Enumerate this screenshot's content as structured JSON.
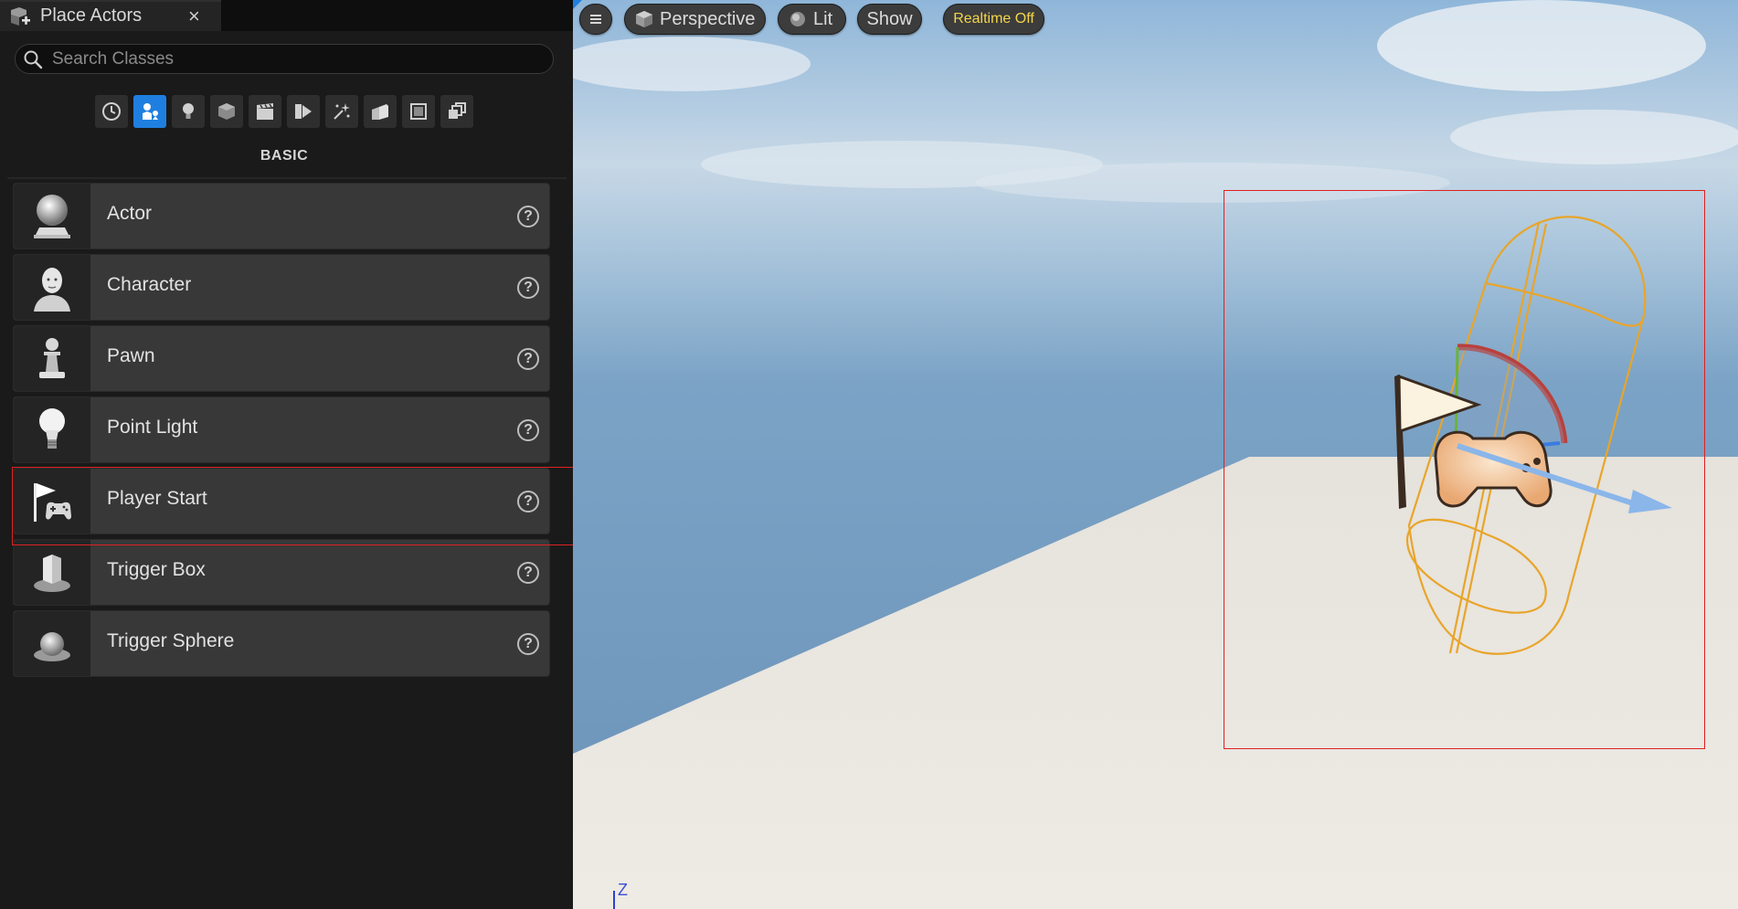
{
  "panel": {
    "tab_title": "Place Actors",
    "close_glyph": "×",
    "search": {
      "placeholder": "Search Classes",
      "value": ""
    },
    "categories": [
      {
        "name": "recently-placed-icon",
        "active": false
      },
      {
        "name": "basic-shapes-icon",
        "active": true
      },
      {
        "name": "lights-icon",
        "active": false
      },
      {
        "name": "shapes-cube-icon",
        "active": false
      },
      {
        "name": "cinematic-icon",
        "active": false
      },
      {
        "name": "visual-effects-icon",
        "active": false
      },
      {
        "name": "particles-icon",
        "active": false
      },
      {
        "name": "geometry-icon",
        "active": false
      },
      {
        "name": "volumes-icon",
        "active": false
      },
      {
        "name": "all-classes-icon",
        "active": false
      }
    ],
    "section_title": "BASIC",
    "actors": [
      {
        "label": "Actor",
        "icon": "actor-sphere-icon"
      },
      {
        "label": "Character",
        "icon": "character-head-icon"
      },
      {
        "label": "Pawn",
        "icon": "pawn-icon"
      },
      {
        "label": "Point Light",
        "icon": "light-bulb-icon"
      },
      {
        "label": "Player Start",
        "icon": "player-start-flag-icon",
        "highlighted": true
      },
      {
        "label": "Trigger Box",
        "icon": "trigger-box-icon"
      },
      {
        "label": "Trigger Sphere",
        "icon": "trigger-sphere-icon"
      }
    ],
    "help_glyph": "?"
  },
  "viewport": {
    "menu_icon": "hamburger-menu-icon",
    "perspective_label": "Perspective",
    "lit_label": "Lit",
    "show_label": "Show",
    "realtime_label": "Realtime Off",
    "axis_label": "Z",
    "colors": {
      "realtime_text": "#f3d54a",
      "selection": "#e02020",
      "capsule": "#e8a52a",
      "accent": "#1f7fe0"
    }
  }
}
